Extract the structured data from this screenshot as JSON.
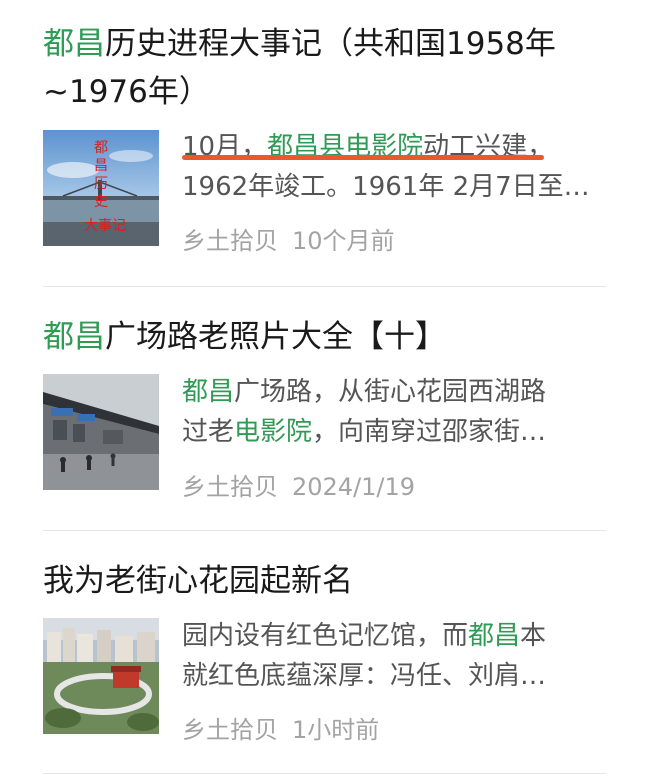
{
  "articles": [
    {
      "title_hl": "都昌",
      "title_rest_line1": "历史进程大事记（共和国1958年",
      "title_line2": "~1976年）",
      "thumb_text": [
        "都",
        "昌",
        "历",
        "史",
        "大事记"
      ],
      "snippet_line1_parts": [
        "10月，",
        "都昌县电影院",
        "动工兴建，"
      ],
      "snippet_line2": "1962年竣工。1961年 2月7日至…",
      "source": "乡土拾贝",
      "time": "10个月前"
    },
    {
      "title_hl": "都昌",
      "title_rest_line1": "广场路老照片大全【十】",
      "snippet_line1_parts": [
        "都昌",
        "广场路，从街心花园西湖路"
      ],
      "snippet_line2_parts": [
        "过老",
        "电影院",
        "，向南穿过邵家街…"
      ],
      "source": "乡土拾贝",
      "time": "2024/1/19"
    },
    {
      "title_line1": "我为老街心花园起新名",
      "snippet_line1_parts": [
        "园内设有红色记忆馆，而",
        "都昌",
        "本"
      ],
      "snippet_line2": "就红色底蕴深厚：冯任、刘肩…",
      "source": "乡土拾贝",
      "time": "1小时前"
    }
  ],
  "colors": {
    "highlight": "#2f9b55",
    "underline": "#e85a2a",
    "meta": "#a3a3a3"
  }
}
